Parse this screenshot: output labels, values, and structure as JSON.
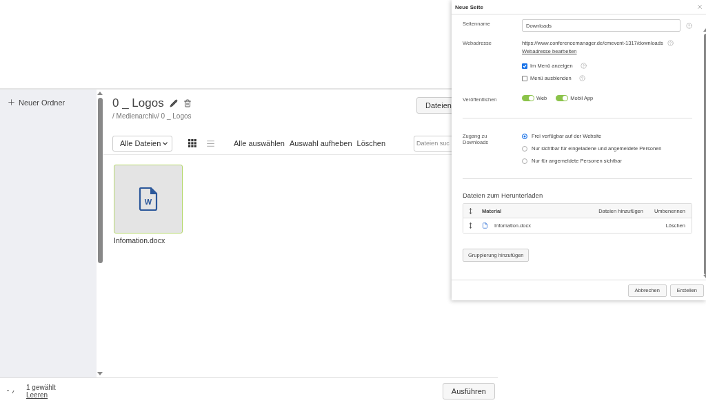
{
  "sidebar": {
    "new_folder": "Neuer Ordner"
  },
  "folder": {
    "title": "0 _ Logos",
    "breadcrumb": "/ Medienarchiv/ 0 _ Logos",
    "upload_button": "Dateien"
  },
  "toolbar": {
    "filter": "Alle Dateien",
    "views": [
      {
        "kind": "grid",
        "selected": true
      },
      {
        "kind": "list",
        "selected": false
      }
    ],
    "actions": [
      "Alle auswählen",
      "Auswahl aufheben",
      "Löschen"
    ],
    "search": {
      "placeholder": "Dateien suc"
    }
  },
  "files": [
    {
      "name": "Infomation.docx",
      "type_letter": "W",
      "selected": true
    }
  ],
  "selection_bar": {
    "count": "1 gewählt",
    "clear_link": "Leeren",
    "run_button": "Ausführen"
  },
  "dialog": {
    "title": "Neue Seite",
    "page_name": {
      "label": "Seitenname",
      "value": "Downloads"
    },
    "web_address": {
      "label": "Webadresse",
      "url": "https://www.conferencemanager.de/cmevent-1317/downloads",
      "edit_link": "Webadresse bearbeiten"
    },
    "checkboxes": [
      {
        "label": "Im Menü anzeigen",
        "checked": true
      },
      {
        "label": "Menü ausblenden",
        "checked": false
      }
    ],
    "publish": {
      "label": "Veröffentlichen",
      "toggles": [
        {
          "label": "Web",
          "on": true
        },
        {
          "label": "Mobil App",
          "on": true
        }
      ]
    },
    "access": {
      "label": "Zugang zu Downloads",
      "options": [
        {
          "label": "Frei verfügbar auf der Website",
          "selected": true
        },
        {
          "label": "Nur sichtbar für eingeladene und angemeldete Personen",
          "selected": false
        },
        {
          "label": "Nur für angemeldete Personen sichtbar",
          "selected": false
        }
      ]
    },
    "downloads": {
      "heading": "Dateien zum Herunterladen",
      "column": "Material",
      "header_actions": [
        "Dateien hinzufügen",
        "Umbenennen"
      ],
      "rows": [
        {
          "name": "Infomation.docx",
          "action": "Löschen"
        }
      ],
      "group_button": "Gruppierung hinzufügen"
    },
    "buttons": [
      "Abbrechen",
      "Erstellen"
    ]
  }
}
